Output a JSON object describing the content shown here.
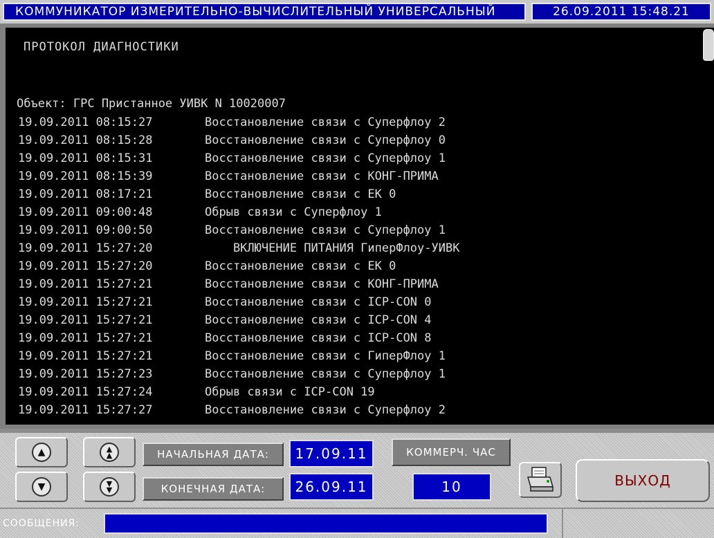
{
  "header": {
    "title": "КОММУНИКАТОР ИЗМЕРИТЕЛЬНО-ВЫЧИСЛИТЕЛЬНЫЙ УНИВЕРСАЛЬНЫЙ",
    "datetime": "26.09.2011 15:48.21"
  },
  "report": {
    "heading": "ПРОТОКОЛ ДИАГНОСТИКИ",
    "object_line": "Объект: ГРС Пристанное  УИВК N 10020007",
    "entries": [
      {
        "ts": "19.09.2011 08:15:27",
        "msg": "Восстановление связи с Суперфлоу 2"
      },
      {
        "ts": "19.09.2011 08:15:28",
        "msg": "Восстановление связи с Суперфлоу 0"
      },
      {
        "ts": "19.09.2011 08:15:31",
        "msg": "Восстановление связи с Суперфлоу 1"
      },
      {
        "ts": "19.09.2011 08:15:39",
        "msg": "Восстановление связи с КОНГ-ПРИМА"
      },
      {
        "ts": "19.09.2011 08:17:21",
        "msg": "Восстановление связи с ЕК 0"
      },
      {
        "ts": "19.09.2011 09:00:48",
        "msg": "Обрыв связи с Суперфлоу 1"
      },
      {
        "ts": "19.09.2011 09:00:50",
        "msg": "Восстановление связи с Суперфлоу 1"
      },
      {
        "ts": "19.09.2011 15:27:20",
        "msg": "    ВКЛЮЧЕНИЕ ПИТАНИЯ ГиперФлоу-УИВК"
      },
      {
        "ts": "19.09.2011 15:27:20",
        "msg": "Восстановление связи с ЕК 0"
      },
      {
        "ts": "19.09.2011 15:27:21",
        "msg": "Восстановление связи с КОНГ-ПРИМА"
      },
      {
        "ts": "19.09.2011 15:27:21",
        "msg": "Восстановление связи с ICP-CON 0"
      },
      {
        "ts": "19.09.2011 15:27:21",
        "msg": "Восстановление связи с ICP-CON 4"
      },
      {
        "ts": "19.09.2011 15:27:21",
        "msg": "Восстановление связи с ICP-CON 8"
      },
      {
        "ts": "19.09.2011 15:27:21",
        "msg": "Восстановление связи с ГиперФлоу 1"
      },
      {
        "ts": "19.09.2011 15:27:23",
        "msg": "Восстановление связи с Суперфлоу 1"
      },
      {
        "ts": "19.09.2011 15:27:24",
        "msg": "Обрыв связи с ICP-CON 19"
      },
      {
        "ts": "19.09.2011 15:27:27",
        "msg": "Восстановление связи с Суперфлоу 2"
      }
    ]
  },
  "controls": {
    "start_date_label": "НАЧАЛЬНАЯ ДАТА:",
    "start_date_value": "17.09.11",
    "end_date_label": "КОНЕЧНАЯ ДАТА:",
    "end_date_value": "26.09.11",
    "commercial_hour_label": "КОММЕРЧ. ЧАС",
    "commercial_hour_value": "10",
    "exit_label": "ВЫХОД",
    "messages_label": "СООБЩЕНИЯ:",
    "messages_value": ""
  },
  "icons": {
    "scroll_up": "up-arrow-icon",
    "page_up": "double-up-arrow-icon",
    "scroll_down": "down-arrow-icon",
    "page_down": "double-down-arrow-icon",
    "print": "printer-icon"
  },
  "colors": {
    "header_bg": "#0000a8",
    "value_bg": "#0000c0",
    "report_bg": "#000000",
    "report_text": "#dcdcdc",
    "exit_text": "#800000"
  }
}
